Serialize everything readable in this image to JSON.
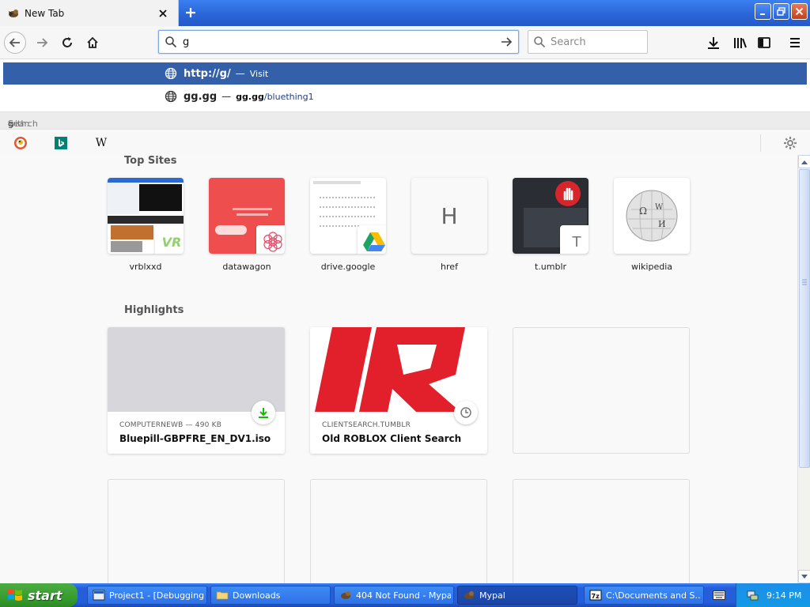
{
  "tab": {
    "title": "New Tab"
  },
  "navbar": {
    "url_value": "g",
    "search_placeholder": "Search"
  },
  "suggestions": [
    {
      "title": "http://g/",
      "separator": "—",
      "action": "Visit"
    },
    {
      "title": "gg.gg",
      "separator": "—",
      "url_bold": "gg.gg",
      "url_rest": "/bluething1"
    }
  ],
  "search_with": {
    "prefix": "Search for ",
    "query": "g",
    "suffix": " with:"
  },
  "engines": [
    {
      "name": "duckduckgo-icon"
    },
    {
      "name": "bing-icon"
    },
    {
      "name": "wikipedia-icon",
      "glyph": "W"
    }
  ],
  "top_sites": {
    "title": "Top Sites",
    "items": [
      {
        "label": "vrblxxd",
        "badge": "VR"
      },
      {
        "label": "datawagon"
      },
      {
        "label": "drive.google"
      },
      {
        "label": "href",
        "letter": "H"
      },
      {
        "label": "t.umblr",
        "badge": "T"
      },
      {
        "label": "wikipedia"
      }
    ]
  },
  "highlights": {
    "title": "Highlights",
    "cards": [
      {
        "source": "COMPUTERNEWB — 490 KB",
        "title": "Bluepill-GBPFRE_EN_DV1.iso",
        "icon": "download-icon"
      },
      {
        "source": "CLIENTSEARCH.TUMBLR",
        "title": "Old ROBLOX Client Search",
        "icon": "clock-icon"
      }
    ]
  },
  "taskbar": {
    "start_label": "start",
    "tasks": [
      {
        "label": "Project1 - [Debugging..."
      },
      {
        "label": "Downloads"
      },
      {
        "label": "404 Not Found - Mypal"
      },
      {
        "label": "Mypal",
        "active": true
      },
      {
        "label": "C:\\Documents and S..."
      }
    ],
    "clock": "9:14 PM"
  },
  "colors": {
    "selected_row": "#3360a8",
    "taskbar": "#245edb",
    "start": "#379d2e",
    "accent_download": "#12bc00"
  }
}
